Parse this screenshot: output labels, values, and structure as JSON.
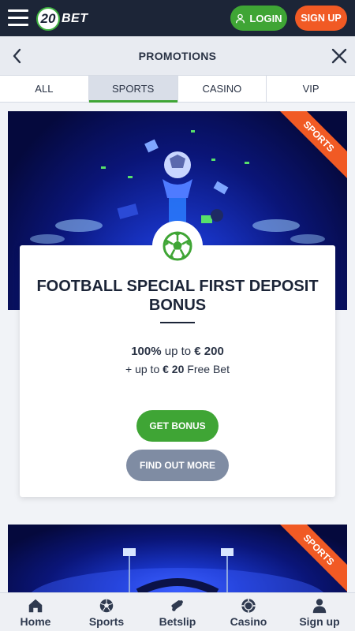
{
  "header": {
    "logo_number": "20",
    "logo_text": "BET",
    "login_label": "LOGIN",
    "signup_label": "SIGN UP"
  },
  "titlebar": {
    "title": "PROMOTIONS"
  },
  "tabs": [
    {
      "label": "ALL",
      "active": false
    },
    {
      "label": "SPORTS",
      "active": true
    },
    {
      "label": "CASINO",
      "active": false
    },
    {
      "label": "VIP",
      "active": false
    }
  ],
  "promos": [
    {
      "ribbon": "SPORTS",
      "title": "FOOTBALL SPECIAL FIRST DEPOSIT BONUS",
      "line1_bold": "100%",
      "line1_mid": " up to ",
      "line1_amount": "€ 200",
      "line2_prefix": "+ up to ",
      "line2_amount": "€ 20",
      "line2_suffix": " Free Bet",
      "get_bonus_label": "GET BONUS",
      "find_out_more_label": "FIND OUT MORE"
    },
    {
      "ribbon": "SPORTS"
    }
  ],
  "bottom_nav": [
    {
      "label": "Home",
      "icon": "home-icon"
    },
    {
      "label": "Sports",
      "icon": "football-icon"
    },
    {
      "label": "Betslip",
      "icon": "betslip-icon"
    },
    {
      "label": "Casino",
      "icon": "casino-chip-icon"
    },
    {
      "label": "Sign up",
      "icon": "user-icon"
    }
  ],
  "colors": {
    "header_bg": "#1c2537",
    "accent_green": "#3fa535",
    "accent_orange": "#f15a24",
    "secondary_button": "#7f8ca3"
  }
}
